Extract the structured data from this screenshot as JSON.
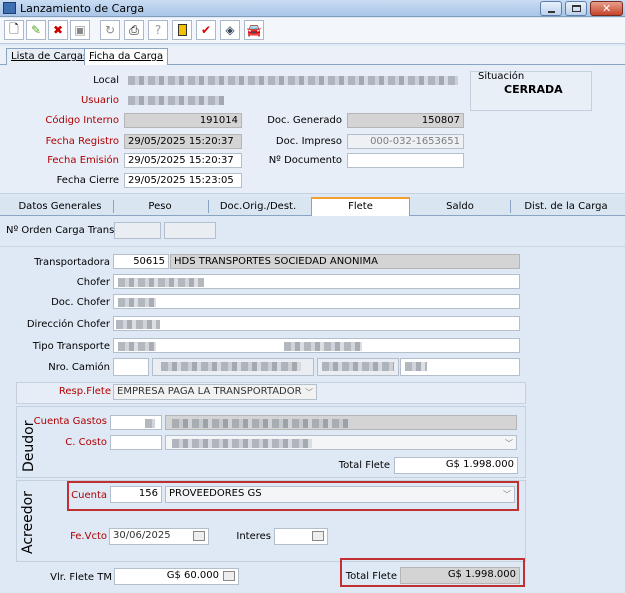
{
  "window": {
    "title": "Lanzamiento de Carga"
  },
  "toolbar": {
    "icons": [
      "new-doc-icon",
      "edit-icon",
      "delete-icon",
      "save-icon",
      "undo-icon",
      "print-icon",
      "help-icon",
      "flag-icon",
      "check-icon",
      "link-icon",
      "car-icon"
    ],
    "help_label": "?"
  },
  "outer_tabs": [
    "Lista de Cargas",
    "Ficha da Carga"
  ],
  "header": {
    "local_label": "Local",
    "usuario_label": "Usuario",
    "codigo_interno_label": "Código Interno",
    "codigo_interno": "191014",
    "doc_generado_label": "Doc. Generado",
    "doc_generado": "150807",
    "fecha_registro_label": "Fecha Registro",
    "fecha_registro": "29/05/2025 15:20:37",
    "doc_impreso_label": "Doc. Impreso",
    "doc_impreso": "000-032-1653651",
    "fecha_emision_label": "Fecha Emisión",
    "fecha_emision": "29/05/2025 15:20:37",
    "nro_documento_label": "Nº Documento",
    "nro_documento": "",
    "fecha_cierre_label": "Fecha Cierre",
    "fecha_cierre": "29/05/2025 15:23:05",
    "situacion_label": "Situación",
    "situacion": "CERRADA"
  },
  "inner_tabs": [
    "Datos Generales",
    "Peso",
    "Doc.Orig./Dest.",
    "Flete",
    "Saldo",
    "Dist. de la Carga"
  ],
  "flete": {
    "orden_label": "Nº Orden Carga Transp.",
    "transportadora_label": "Transportadora",
    "transportadora_code": "50615",
    "transportadora_name": "HDS TRANSPORTES SOCIEDAD ANONIMA",
    "chofer_label": "Chofer",
    "doc_chofer_label": "Doc. Chofer",
    "direccion_chofer_label": "Dirección Chofer",
    "tipo_transporte_label": "Tipo Transporte",
    "nro_camion_label": "Nro. Camión",
    "resp_flete_label": "Resp.Flete",
    "resp_flete": "EMPRESA PAGA LA TRANSPORTADOR",
    "deudor_label": "Deudor",
    "cuenta_gastos_label": "Cuenta Gastos",
    "c_costo_label": "C. Costo",
    "total_flete_deudor_label": "Total Flete",
    "total_flete_deudor": "G$ 1.998.000",
    "acreedor_label": "Acreedor",
    "cuenta_label": "Cuenta",
    "cuenta_code": "156",
    "cuenta_name": "PROVEEDORES GS",
    "fe_vcto_label": "Fe.Vcto",
    "fe_vcto": "30/06/2025",
    "interes_label": "Interes",
    "vlr_flete_tm_label": "Vlr. Flete TM",
    "vlr_flete_tm": "G$ 60.000",
    "total_flete_label": "Total Flete",
    "total_flete": "G$ 1.998.000"
  }
}
